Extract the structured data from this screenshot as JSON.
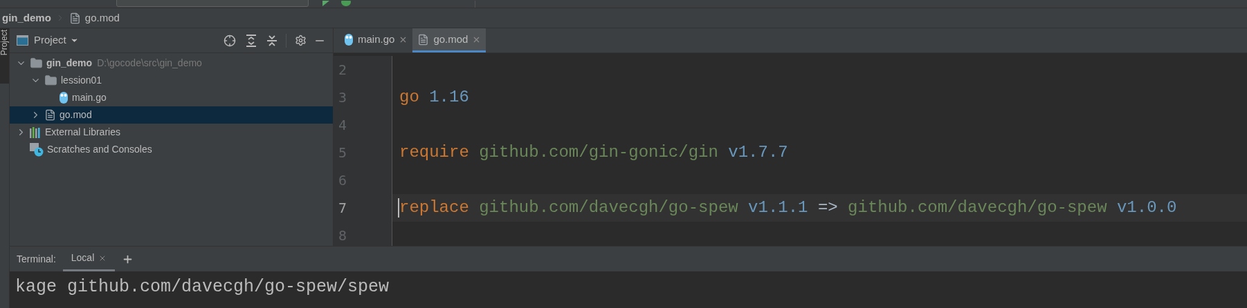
{
  "breadcrumb": [
    {
      "label": "gin_demo",
      "kind": "folder"
    },
    {
      "label": "go.mod",
      "kind": "file"
    }
  ],
  "side_tab": "Project",
  "project_panel": {
    "title": "Project",
    "tree": [
      {
        "label": "gin_demo",
        "path": "D:\\gocode\\src\\gin_demo",
        "kind": "folder",
        "expanded": true,
        "selected": false,
        "children": [
          {
            "label": "lession01",
            "kind": "folder",
            "expanded": true,
            "selected": false,
            "children": [
              {
                "label": "main.go",
                "kind": "go",
                "selected": false
              }
            ]
          },
          {
            "label": "go.mod",
            "kind": "file",
            "expanded": false,
            "selected": true
          }
        ]
      },
      {
        "label": "External Libraries",
        "kind": "libraries",
        "expanded": false,
        "selected": false
      },
      {
        "label": "Scratches and Consoles",
        "kind": "scratches",
        "selected": false
      }
    ]
  },
  "tabs": [
    {
      "label": "main.go",
      "kind": "go",
      "selected": false
    },
    {
      "label": "go.mod",
      "kind": "file",
      "selected": true
    }
  ],
  "editor": {
    "lines": [
      {
        "number": "2",
        "current": false
      },
      {
        "number": "3",
        "current": false,
        "tokens": [
          {
            "text": "go",
            "kind": "keyword"
          },
          {
            "text": "1.16",
            "kind": "number"
          }
        ]
      },
      {
        "number": "4",
        "current": false
      },
      {
        "number": "5",
        "current": false,
        "tokens": [
          {
            "text": "require",
            "kind": "keyword"
          },
          {
            "text": "github.com/gin-gonic/gin",
            "kind": "string"
          },
          {
            "text": "v1.7.7",
            "kind": "number"
          }
        ]
      },
      {
        "number": "6",
        "current": false
      },
      {
        "number": "7",
        "current": true,
        "tokens": [
          {
            "text": "replace",
            "kind": "keyword"
          },
          {
            "text": "github.com/davecgh/go-spew",
            "kind": "string"
          },
          {
            "text": "v1.1.1",
            "kind": "number"
          },
          {
            "text": "=>",
            "kind": "operator"
          },
          {
            "text": "github.com/davecgh/go-spew",
            "kind": "string"
          },
          {
            "text": "v1.0.0",
            "kind": "number"
          }
        ]
      },
      {
        "number": "8",
        "current": false
      }
    ]
  },
  "terminal": {
    "label": "Terminal:",
    "tabs": [
      {
        "label": "Local",
        "selected": true
      }
    ],
    "output": "kage github.com/davecgh/go-spew/spew"
  }
}
